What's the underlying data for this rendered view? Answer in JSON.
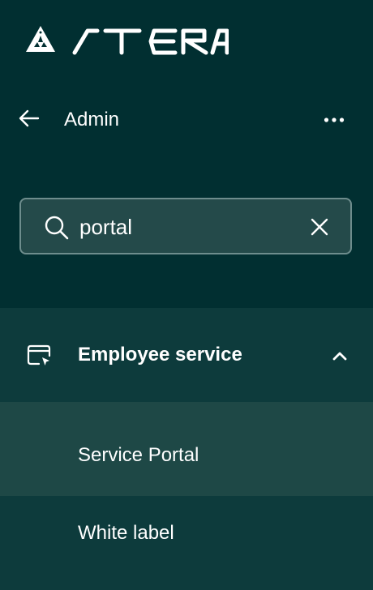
{
  "brand": {
    "logo_text": "ATERA"
  },
  "topbar": {
    "title": "Admin",
    "back_icon": "arrow-left-icon",
    "more_icon": "more-horizontal-icon"
  },
  "search": {
    "value": "portal",
    "icon": "search-icon",
    "clear_icon": "close-icon"
  },
  "menu": {
    "section": {
      "label": "Employee service",
      "icon": "browser-cursor-icon",
      "chevron": "chevron-up-icon",
      "expanded": true
    },
    "items": [
      {
        "label": "Service Portal",
        "active": true
      },
      {
        "label": "White label",
        "active": false
      }
    ]
  },
  "colors": {
    "background": "#012f31",
    "section_background": "#0d3b3c",
    "active_item_background": "#1e4846",
    "search_background": "#244a4a",
    "search_border": "#6e8d8d",
    "text": "#ffffff"
  }
}
